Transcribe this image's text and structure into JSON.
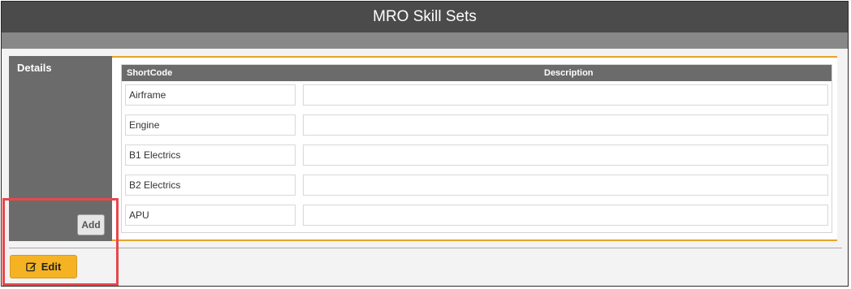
{
  "window": {
    "title": "MRO Skill Sets"
  },
  "sidebar": {
    "title": "Details",
    "add_label": "Add"
  },
  "table": {
    "columns": [
      "ShortCode",
      "Description"
    ],
    "rows": [
      {
        "shortcode": "Airframe",
        "description": ""
      },
      {
        "shortcode": "Engine",
        "description": ""
      },
      {
        "shortcode": "B1 Electrics",
        "description": ""
      },
      {
        "shortcode": "B2 Electrics",
        "description": ""
      },
      {
        "shortcode": "APU",
        "description": ""
      }
    ]
  },
  "footer": {
    "edit_label": "Edit",
    "edit_icon": "edit-icon"
  },
  "colors": {
    "title_bar": "#4b4b4b",
    "accent_orange": "#f5b324",
    "highlight_red": "#e8474b"
  }
}
